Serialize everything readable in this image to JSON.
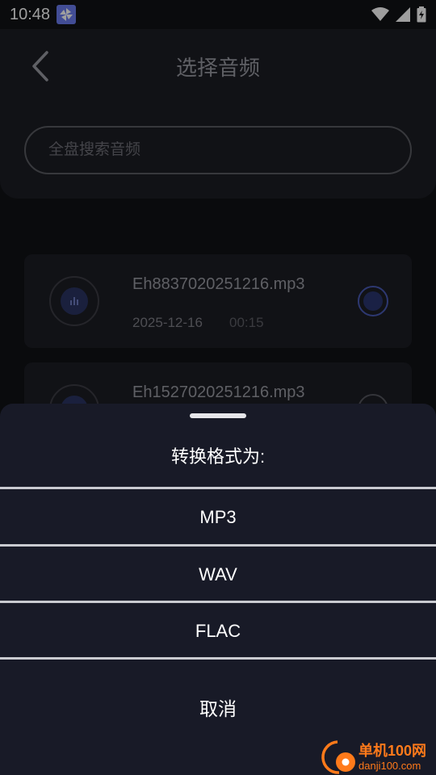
{
  "status_bar": {
    "time": "10:48"
  },
  "header": {
    "title": "选择音频"
  },
  "search": {
    "placeholder": "全盘搜索音频"
  },
  "files": [
    {
      "name": "Eh8837020251216.mp3",
      "date": "2025-12-16",
      "duration": "00:15",
      "selected": true
    },
    {
      "name": "Eh1527020251216.mp3",
      "selected": false
    }
  ],
  "sheet": {
    "title": "转换格式为:",
    "options": [
      "MP3",
      "WAV",
      "FLAC"
    ],
    "cancel": "取消"
  },
  "watermark": {
    "name": "单机100网",
    "url": "danji100.com"
  },
  "colors": {
    "accent": "#4a5bb6",
    "sheet_bg": "#181a27",
    "watermark": "#ff7a1a"
  }
}
